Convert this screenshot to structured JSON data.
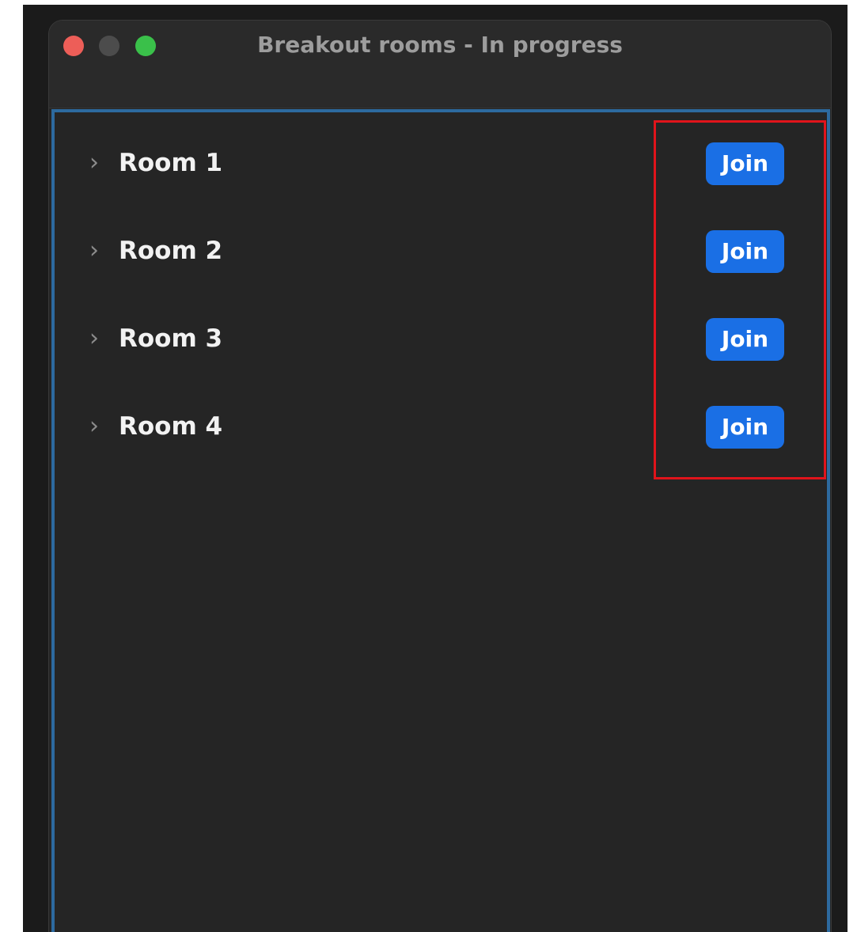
{
  "window": {
    "title": "Breakout rooms - In progress"
  },
  "rooms": [
    {
      "label": "Room 1",
      "join_label": "Join"
    },
    {
      "label": "Room 2",
      "join_label": "Join"
    },
    {
      "label": "Room 3",
      "join_label": "Join"
    },
    {
      "label": "Room 4",
      "join_label": "Join"
    }
  ],
  "colors": {
    "background": "#252525",
    "join_button": "#1a6fe5",
    "panel_border": "#2d6a9f",
    "highlight_border": "#e0141b",
    "close_button": "#ed5e58",
    "minimize_button": "#4c4c4c",
    "zoom_button": "#3ac04a"
  },
  "icons": {
    "expand": "chevron-right-icon"
  }
}
